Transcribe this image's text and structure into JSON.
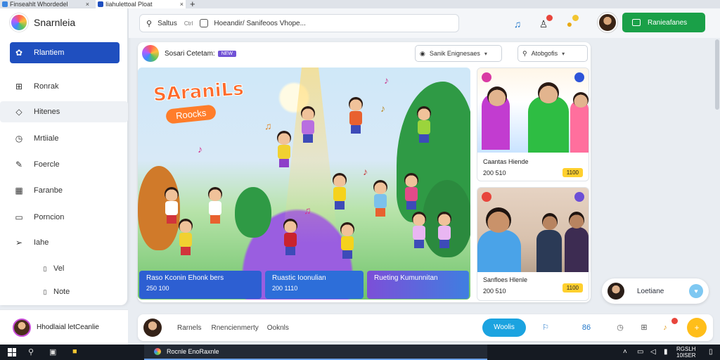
{
  "browser": {
    "tabs": [
      {
        "label": "Finseahlt Whordedel"
      },
      {
        "label": "Iiahulettoal Ploat"
      }
    ]
  },
  "sidebar": {
    "brand": "Snarnleia",
    "items": [
      {
        "label": "Rlantiem",
        "icon": "leaf-icon",
        "active": true
      },
      {
        "label": "Ronrak",
        "icon": "grid-icon"
      },
      {
        "label": "Hitenes",
        "icon": "tag-icon"
      },
      {
        "label": "Mrtiiale",
        "icon": "clock-icon"
      },
      {
        "label": "Foercle",
        "icon": "edit-icon"
      },
      {
        "label": "Faranbe",
        "icon": "chart-icon"
      },
      {
        "label": "Porncion",
        "icon": "card-icon"
      },
      {
        "label": "Iahe",
        "icon": "send-icon"
      },
      {
        "label": "Vel",
        "icon": "doc-icon"
      },
      {
        "label": "Note",
        "icon": "note-icon"
      }
    ],
    "profile_name": "Hhodlaial letCeanlie"
  },
  "topbar": {
    "search_prefix": "Saltus",
    "search_kbd": "Ctrl",
    "search_text": "Hoeandir/ Sanifeoos Vhope...",
    "button_label": "Ranieafanes"
  },
  "content": {
    "header_title": "Sosari Cetetam:",
    "header_pill": "NEW",
    "dropdown_left": "Sanik Enignesaes",
    "dropdown_right": "Atobgofis",
    "hero_title_1": "SAraniLs",
    "hero_title_2": "Roocks",
    "captions": [
      {
        "title": "Raso Kconin Ehonk bers",
        "sub": "250 100"
      },
      {
        "title": "Ruastic Ioonulian",
        "sub": "200 1110"
      },
      {
        "title": "Rueting Kumunnitan",
        "sub": ""
      }
    ],
    "cards": [
      {
        "title": "Caantas Hiende",
        "sub": "200 510",
        "rating": "1100"
      },
      {
        "title": "Sanfloes Hlenle",
        "sub": "200 510",
        "rating": "1100"
      }
    ]
  },
  "chat": {
    "label": "Loetiane"
  },
  "composer": {
    "placeholder_1": "Rarnels",
    "placeholder_2": "Rnencienmerty",
    "placeholder_3": "Ooknls",
    "button_label": "Woolis",
    "count": "86"
  },
  "taskbar": {
    "app_label": "Rocnle EnoRaxnle",
    "time": "RGSLH",
    "date": "10ISER"
  },
  "colors": {
    "accent_blue": "#1f4fbf",
    "green_button": "#1aa048",
    "cyan_button": "#1ba3e0",
    "yellow_rating": "#ffd02e"
  }
}
